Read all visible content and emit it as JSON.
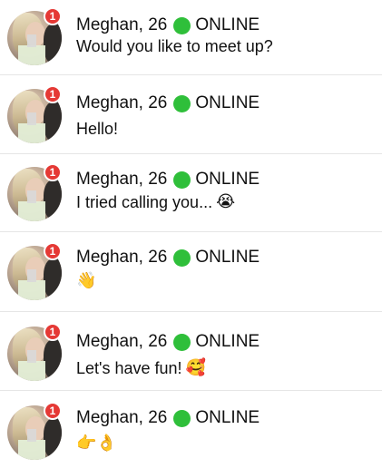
{
  "chat_list": {
    "status_color": "#2fbf3a",
    "badge_color": "#e53935",
    "items": [
      {
        "name": "Meghan, 26",
        "status": "ONLINE",
        "unread": "1",
        "message": "Would you like to meet up?",
        "emoji": ""
      },
      {
        "name": "Meghan, 26",
        "status": "ONLINE",
        "unread": "1",
        "message": "Hello!",
        "emoji": ""
      },
      {
        "name": "Meghan, 26",
        "status": "ONLINE",
        "unread": "1",
        "message": "I tried calling you...",
        "emoji": "😭"
      },
      {
        "name": "Meghan, 26",
        "status": "ONLINE",
        "unread": "1",
        "message": "",
        "emoji": "👋"
      },
      {
        "name": "Meghan, 26",
        "status": "ONLINE",
        "unread": "1",
        "message": "Let's have fun!",
        "emoji": "🥰"
      },
      {
        "name": "Meghan, 26",
        "status": "ONLINE",
        "unread": "1",
        "message": "",
        "emoji": "👉👌"
      }
    ]
  }
}
